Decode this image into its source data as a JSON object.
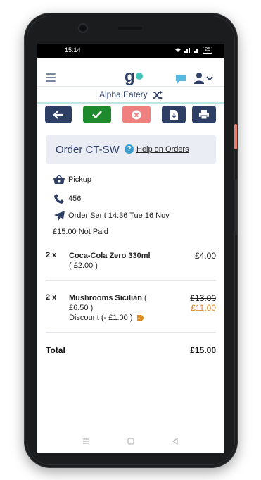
{
  "status_bar": {
    "time": "15:14",
    "battery": "25"
  },
  "app": {
    "logo_text": "g",
    "restaurant_name": "Alpha Eatery",
    "accent": "#2e3f66",
    "brand_teal": "#45c4b8"
  },
  "toolbar": {
    "back": {
      "icon": "arrow-left-icon",
      "color": "#2e3f66"
    },
    "accept": {
      "icon": "check-icon",
      "color": "#1d8a2e"
    },
    "reject": {
      "icon": "x-circle-icon",
      "color": "#f08080"
    },
    "download": {
      "icon": "download-file-icon",
      "color": "#2e3f66"
    },
    "print": {
      "icon": "printer-icon",
      "color": "#2e3f66"
    }
  },
  "order": {
    "title": "Order CT-SW",
    "help_link": "Help on Orders",
    "type": "Pickup",
    "phone": "456",
    "sent": "Order Sent 14:36 Tue 16 Nov",
    "payment": "£15.00 Not Paid"
  },
  "items": [
    {
      "qty": "2 x",
      "name": "Coca-Cola Zero 330ml",
      "unit": "( £2.00 )",
      "price": "£4.00"
    },
    {
      "qty": "2 x",
      "name": "Mushrooms Sicilian",
      "unit_open": " (",
      "unit": "£6.50 )",
      "discount": "Discount (- £1.00 )",
      "original_price": "£13.00",
      "price": "£11.00"
    }
  ],
  "total": {
    "label": "Total",
    "value": "£15.00"
  }
}
